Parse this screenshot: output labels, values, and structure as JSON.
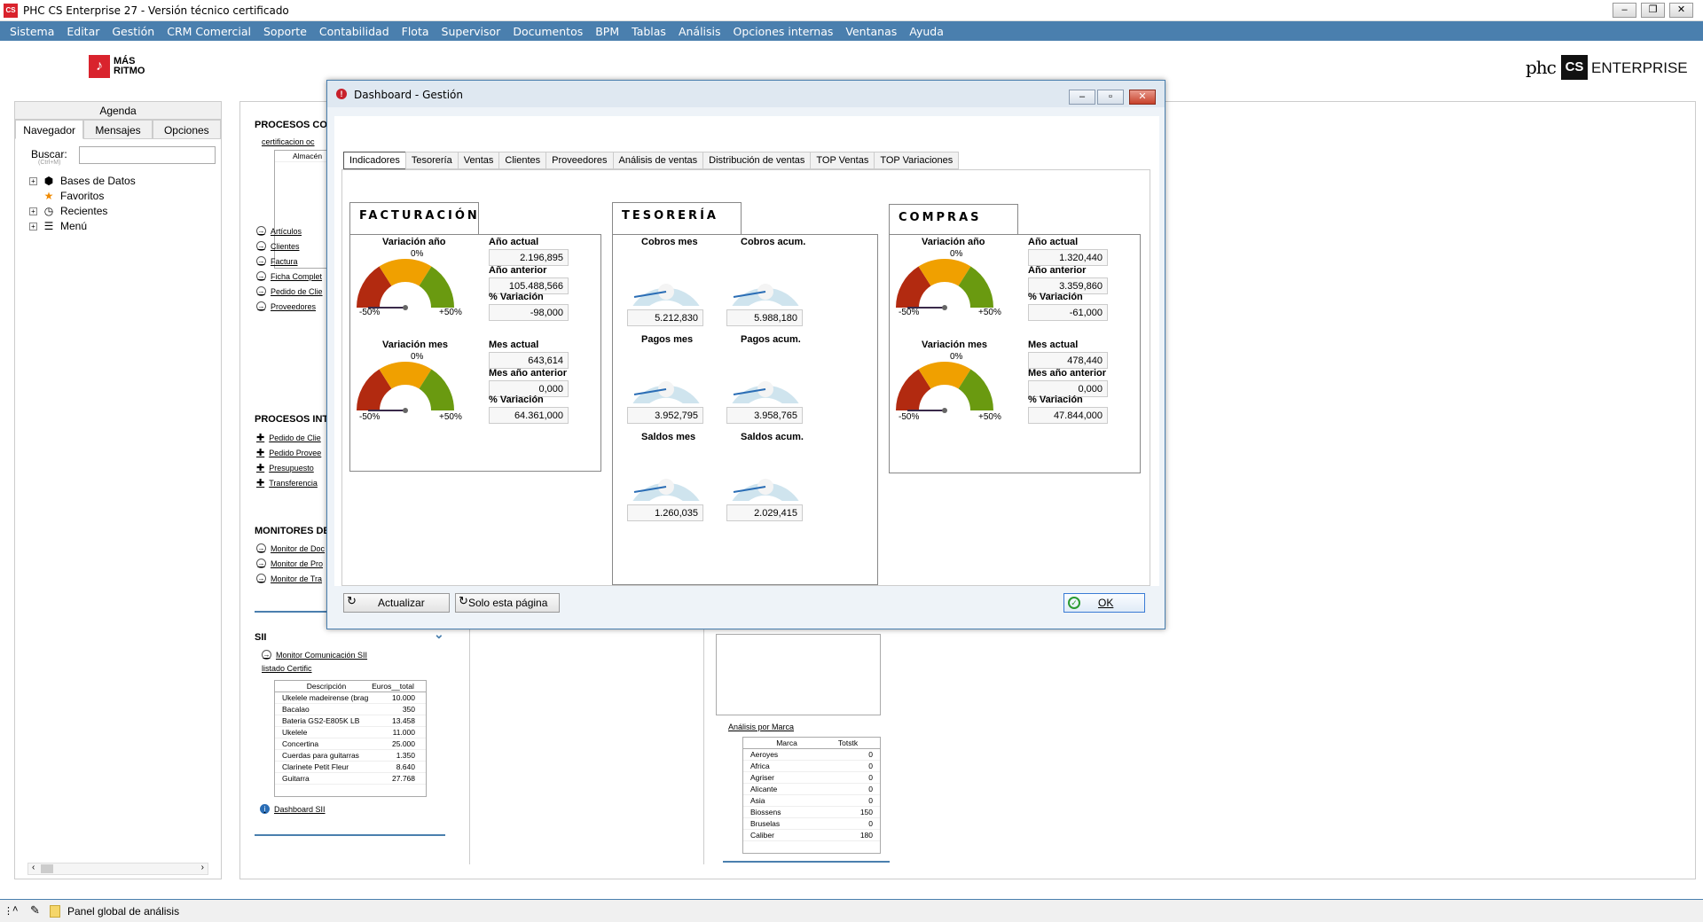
{
  "app": {
    "title": "PHC CS Enterprise 27 - Versión técnico certificado",
    "logo": "CS"
  },
  "menu": [
    "Sistema",
    "Editar",
    "Gestión",
    "CRM Comercial",
    "Soporte",
    "Contabilidad",
    "Flota",
    "Supervisor",
    "Documentos",
    "BPM",
    "Tablas",
    "Análisis",
    "Opciones internas",
    "Ventanas",
    "Ayuda"
  ],
  "brand": {
    "left_icon": "♪",
    "left_line1": "MÁS",
    "left_line2": "RITMO",
    "right_phc": "phc",
    "right_cs": "CS",
    "right_ent": "ENTERPRISE"
  },
  "left": {
    "agenda": "Agenda",
    "tabs": [
      "Navegador",
      "Mensajes",
      "Opciones"
    ],
    "search_label": "Buscar:",
    "search_hint": "(Ctrl+M)",
    "tree": [
      {
        "label": "Bases de Datos",
        "icon": "database-icon"
      },
      {
        "label": "Favoritos",
        "icon": "star-icon"
      },
      {
        "label": "Recientes",
        "icon": "clock-icon"
      },
      {
        "label": "Menú",
        "icon": "menu-icon"
      }
    ]
  },
  "main": {
    "s1": "PROCESOS CON",
    "s1_grid_title": "certificacion oc",
    "s1_grid_col": "Almacén",
    "s1_links": [
      "Artículos",
      "Clientes",
      "Factura",
      "Ficha Complet",
      "Pedido de Clie",
      "Proveedores"
    ],
    "s2": "PROCESOS INTR",
    "s2_links": [
      "Pedido de Clie",
      "Pedido Provee",
      "Presupuesto",
      "Transferencia"
    ],
    "s3": "MONITORES DE",
    "s3_links": [
      "Monitor de Doc",
      "Monitor de Pro",
      "Monitor de Tra"
    ],
    "sii": "SII",
    "sii_link1": "Monitor Comunicación SII",
    "sii_grid_title": "listado Certific",
    "sii_cols": [
      "Descripción",
      "Euros__total"
    ],
    "sii_rows": [
      [
        "Ukelele madeirense (brag",
        "10.000"
      ],
      [
        "Bacalao",
        "350"
      ],
      [
        "Bateria GS2-E805K LB",
        "13.458"
      ],
      [
        "Ukelele",
        "11.000"
      ],
      [
        "Concertina",
        "25.000"
      ],
      [
        "Cuerdas para guitarras",
        "1.350"
      ],
      [
        "Clarinete Petit Fleur",
        "8.640"
      ],
      [
        "Guitarra",
        "27.768"
      ]
    ],
    "sii_link2": "Dashboard SII",
    "marca_title": "Análisis por Marca",
    "marca_cols": [
      "Marca",
      "Totstk"
    ],
    "marca_rows": [
      [
        "Aeroyes",
        "0"
      ],
      [
        "Africa",
        "0"
      ],
      [
        "Agriser",
        "0"
      ],
      [
        "Alicante",
        "0"
      ],
      [
        "Asia",
        "0"
      ],
      [
        "Biossens",
        "150"
      ],
      [
        "Bruselas",
        "0"
      ],
      [
        "Caliber",
        "180"
      ]
    ]
  },
  "taskbar": {
    "label": "Panel global de análisis"
  },
  "dialog": {
    "title": "Dashboard - Gestión",
    "tabs": [
      "Indicadores",
      "Tesorería",
      "Ventas",
      "Clientes",
      "Proveedores",
      "Análisis de ventas",
      "Distribución de ventas",
      "TOP Ventas",
      "TOP Variaciones"
    ],
    "fact": {
      "title": "FACTURACIÓN",
      "g1": "Variación año",
      "g1_zero": "0%",
      "g2": "Variación mes",
      "g2_zero": "0%",
      "min": "-50%",
      "max": "+50%",
      "f": [
        {
          "l": "Año actual",
          "v": "2.196,895"
        },
        {
          "l": "Año anterior",
          "v": "105.488,566"
        },
        {
          "l": "% Variación",
          "v": "-98,000"
        },
        {
          "l": "Mes actual",
          "v": "643,614"
        },
        {
          "l": "Mes año anterior",
          "v": "0,000"
        },
        {
          "l": "% Variación",
          "v": "64.361,000"
        }
      ]
    },
    "teso": {
      "title": "TESORERÍA",
      "g": [
        {
          "l": "Cobros mes",
          "v": "5.212,830"
        },
        {
          "l": "Cobros acum.",
          "v": "5.988,180"
        },
        {
          "l": "Pagos mes",
          "v": "3.952,795"
        },
        {
          "l": "Pagos acum.",
          "v": "3.958,765"
        },
        {
          "l": "Saldos mes",
          "v": "1.260,035"
        },
        {
          "l": "Saldos acum.",
          "v": "2.029,415"
        }
      ]
    },
    "comp": {
      "title": "COMPRAS",
      "g1": "Variación año",
      "g1_zero": "0%",
      "g2": "Variación mes",
      "g2_zero": "0%",
      "min": "-50%",
      "max": "+50%",
      "f": [
        {
          "l": "Año actual",
          "v": "1.320,440"
        },
        {
          "l": "Año anterior",
          "v": "3.359,860"
        },
        {
          "l": "% Variación",
          "v": "-61,000"
        },
        {
          "l": "Mes actual",
          "v": "478,440"
        },
        {
          "l": "Mes año anterior",
          "v": "0,000"
        },
        {
          "l": "% Variación",
          "v": "47.844,000"
        }
      ]
    },
    "btn_refresh": "Actualizar",
    "btn_page": "Solo esta página",
    "btn_ok": "OK",
    "colors": {
      "red": "#b22a10",
      "orange": "#f0a000",
      "green": "#6a9a10",
      "tesoArc": "#cfe4ee",
      "needle": "#2a6db5"
    }
  }
}
